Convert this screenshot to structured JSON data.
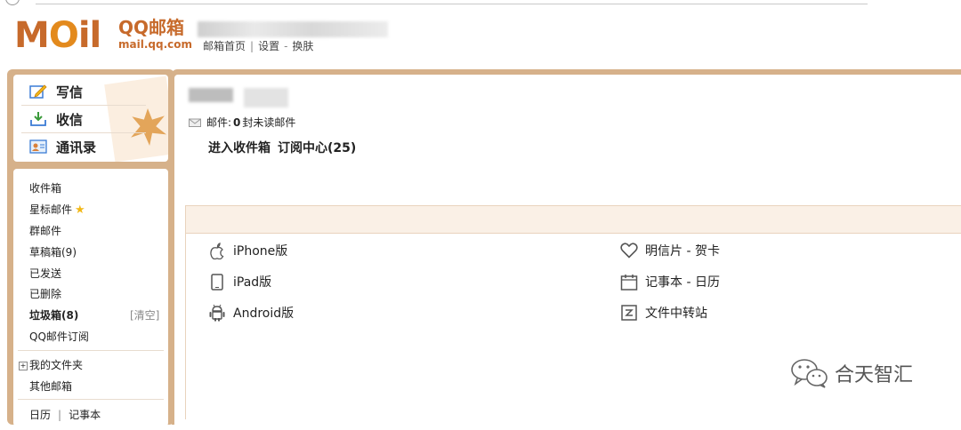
{
  "header": {
    "logo_moil": "MOil",
    "logo_title": "QQ邮箱",
    "logo_sub": "mail.qq.com",
    "links": [
      "邮箱首页",
      "设置",
      "换肤"
    ]
  },
  "quick_actions": [
    {
      "label": "写信",
      "icon": "compose-icon"
    },
    {
      "label": "收信",
      "icon": "inbox-download-icon"
    },
    {
      "label": "通讯录",
      "icon": "contacts-icon"
    }
  ],
  "nav": {
    "inbox": "收件箱",
    "starred": "星标邮件",
    "group": "群邮件",
    "drafts": "草稿箱(9)",
    "sent": "已发送",
    "deleted": "已删除",
    "spam": "垃圾箱(8)",
    "spam_clear": "[清空]",
    "subscriptions": "QQ邮件订阅",
    "my_folders": "我的文件夹",
    "other_mailboxes": "其他邮箱",
    "calendar": "日历",
    "notes": "记事本"
  },
  "main": {
    "mail_label": "邮件:",
    "mail_count": "0",
    "mail_unread": "封未读邮件",
    "goto_inbox": "进入收件箱",
    "subscription_center": "订阅中心(25)"
  },
  "apps": [
    {
      "label": "iPhone版",
      "icon": "apple-icon"
    },
    {
      "label": "iPad版",
      "icon": "tablet-icon"
    },
    {
      "label": "Android版",
      "icon": "android-icon"
    },
    {
      "label": "明信片 - 贺卡",
      "icon": "heart-icon"
    },
    {
      "label": "记事本 - 日历",
      "icon": "calendar-icon"
    },
    {
      "label": "文件中转站",
      "icon": "file-transfer-icon"
    }
  ],
  "watermark": "合天智汇",
  "colors": {
    "brand": "#c76a2b",
    "frame": "#d6b18a",
    "star": "#f2b817"
  }
}
